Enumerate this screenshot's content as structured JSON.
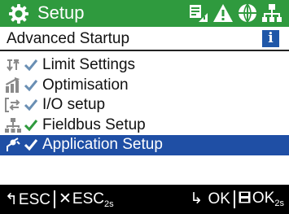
{
  "header": {
    "title": "Setup",
    "background": "#2f9a3e",
    "icons": [
      "gear-icon",
      "io-status-icon",
      "warning-icon",
      "globe-icon",
      "fieldbus-icon"
    ]
  },
  "subheader": {
    "title": "Advanced Startup",
    "info_label": "i"
  },
  "menu": {
    "items": [
      {
        "label": "Limit Settings",
        "icon": "limit-icon",
        "check_color": "#6a8fb4",
        "selected": false
      },
      {
        "label": "Optimisation",
        "icon": "optimisation-icon",
        "check_color": "#6a8fb4",
        "selected": false
      },
      {
        "label": "I/O setup",
        "icon": "io-setup-icon",
        "check_color": "#6a8fb4",
        "selected": false
      },
      {
        "label": "Fieldbus Setup",
        "icon": "network-icon",
        "check_color": "#2f9a3e",
        "selected": false
      },
      {
        "label": "Application Setup",
        "icon": "application-icon",
        "check_color": "#ffffff",
        "selected": true
      }
    ],
    "selected_background": "#1f4fa5"
  },
  "footer": {
    "esc_glyph": "↰",
    "esc_label": "ESC",
    "esc2_glyph": "✕",
    "esc2_label": "ESC",
    "esc2_sub": "2s",
    "ok_glyph": "↳",
    "ok_label": "OK",
    "ok2_label": "OK",
    "ok2_sub": "2s"
  }
}
